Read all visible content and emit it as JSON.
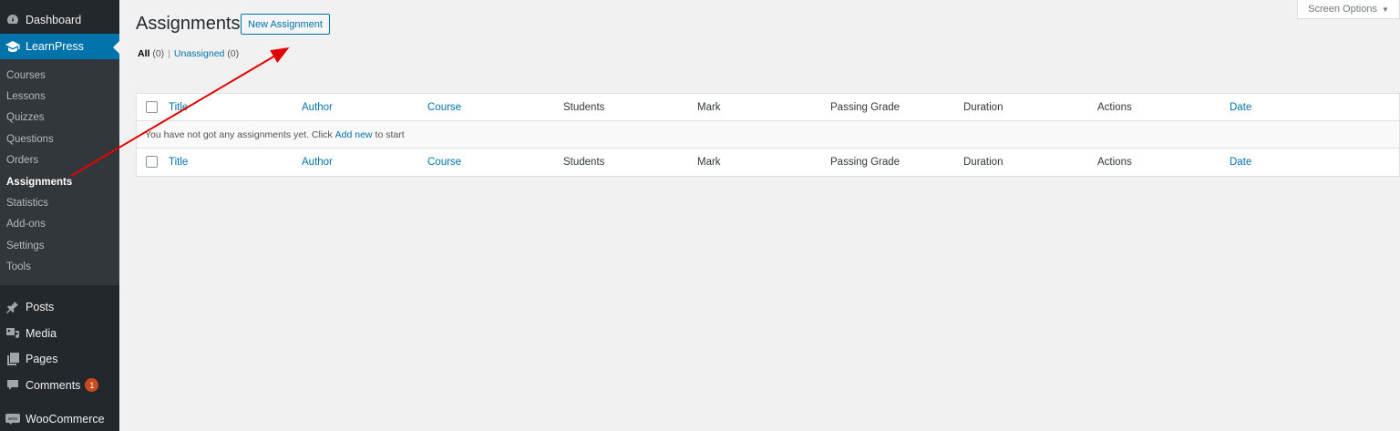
{
  "sidebar": {
    "dashboard": "Dashboard",
    "learnpress": "LearnPress",
    "submenu": [
      "Courses",
      "Lessons",
      "Quizzes",
      "Questions",
      "Orders",
      "Assignments",
      "Statistics",
      "Add-ons",
      "Settings",
      "Tools"
    ],
    "current_index": 5,
    "posts": "Posts",
    "media": "Media",
    "pages": "Pages",
    "comments": "Comments",
    "comments_badge": "1",
    "woocommerce": "WooCommerce"
  },
  "header": {
    "title": "Assignments",
    "new_button": "New Assignment",
    "screen_options": "Screen Options"
  },
  "filters": {
    "all": "All",
    "all_count": "(0)",
    "unassigned": "Unassigned",
    "unassigned_count": "(0)",
    "separator": "|"
  },
  "table": {
    "columns": [
      "Title",
      "Author",
      "Course",
      "Students",
      "Mark",
      "Passing Grade",
      "Duration",
      "Actions",
      "Date"
    ],
    "sortable": [
      true,
      true,
      true,
      false,
      false,
      false,
      false,
      false,
      true
    ],
    "empty_prefix": "You have not got any assignments yet. Click",
    "empty_link": "Add new",
    "empty_suffix": "to start"
  },
  "colors": {
    "sidebar_bg": "#23282d",
    "submenu_bg": "#32373c",
    "accent": "#0073aa",
    "badge": "#ca4a1f",
    "annotation_arrow": "#e30000"
  }
}
